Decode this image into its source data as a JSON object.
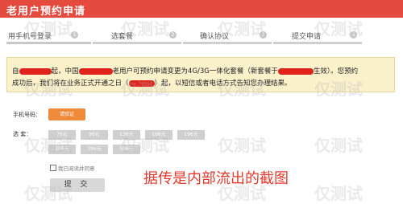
{
  "header": {
    "title": "老用户预约申请"
  },
  "steps": [
    {
      "label": "用手机号登录",
      "num": "1"
    },
    {
      "label": "选套餐",
      "num": "2"
    },
    {
      "label": "确认协议",
      "num": "3"
    },
    {
      "label": "提交申请",
      "num": "4"
    }
  ],
  "notice": {
    "seg1": "自",
    "seg2": "起，中国",
    "seg3": "老用户可预约申请变更为4G/3G一体化套餐（新套餐于",
    "seg4": "生效）。您预约",
    "seg5": "成功后，我们将在业务正式开通之日（",
    "seg6": "）起，以短信或者电话方式告知您办理结果。",
    "colors": {
      "background": "#fbf2cc",
      "redaction": "#e0231c"
    }
  },
  "form": {
    "phone_label": "手机号码：",
    "verify_button": "请验证",
    "package_label": "选    套：",
    "row1": [
      "76元",
      "96元",
      "136元",
      "166元",
      "196元"
    ],
    "row2": [
      "296元",
      "396元",
      "596元"
    ],
    "agree_label": "我已阅读并同意",
    "submit_button": "提 交"
  },
  "overlay": {
    "text": "据传是内部流出的截图"
  },
  "watermark": {
    "text": "仅测试"
  },
  "colors": {
    "header": "#e44a3d",
    "accent": "#f08a3b",
    "overlay_text": "#e23a2e"
  }
}
